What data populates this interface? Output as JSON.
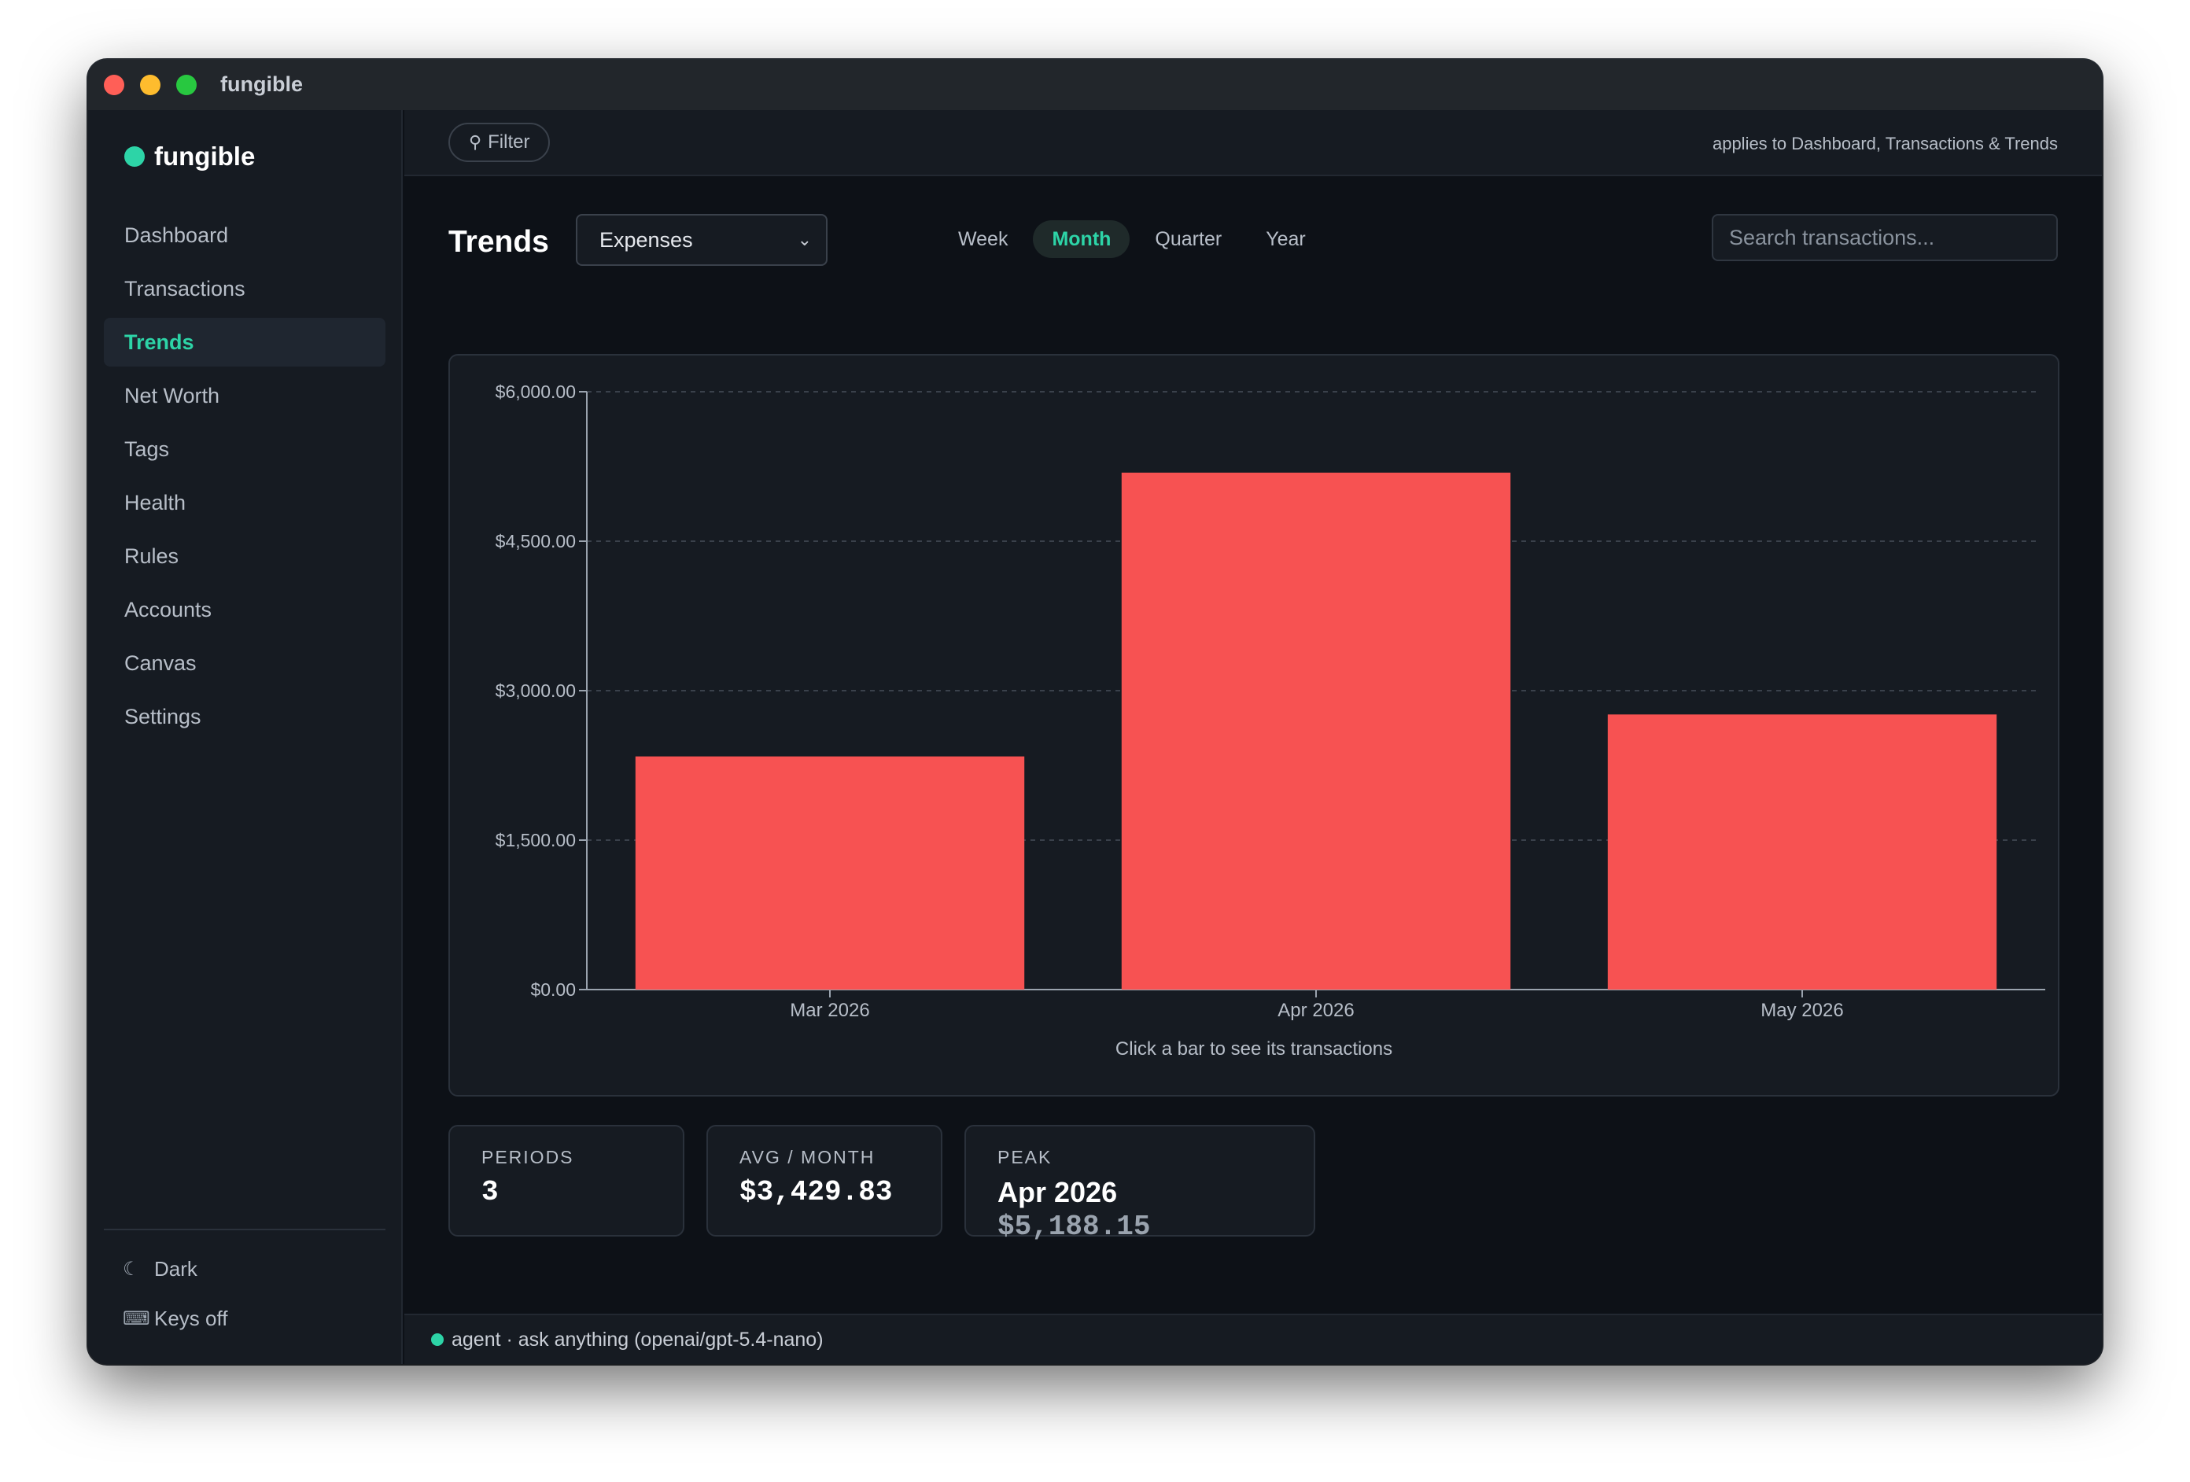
{
  "window": {
    "title": "fungible"
  },
  "sidebar": {
    "brand": "fungible",
    "items": [
      {
        "label": "Dashboard"
      },
      {
        "label": "Transactions"
      },
      {
        "label": "Trends"
      },
      {
        "label": "Net Worth"
      },
      {
        "label": "Tags"
      },
      {
        "label": "Health"
      },
      {
        "label": "Rules"
      },
      {
        "label": "Accounts"
      },
      {
        "label": "Canvas"
      },
      {
        "label": "Settings"
      }
    ],
    "active_index": 2,
    "theme_label": "Dark",
    "keys_label": "Keys off"
  },
  "filterbar": {
    "filter_label": "Filter",
    "note": "applies to Dashboard, Transactions & Trends"
  },
  "trends": {
    "title": "Trends",
    "select_value": "Expenses",
    "periods": [
      "Week",
      "Month",
      "Quarter",
      "Year"
    ],
    "active_period": "Month",
    "search_placeholder": "Search transactions..."
  },
  "colors": {
    "accent": "#2dd4a7",
    "bar": "#f75252"
  },
  "chart_data": {
    "type": "bar",
    "categories": [
      "Mar 2026",
      "Apr 2026",
      "May 2026"
    ],
    "values": [
      2340,
      5188.15,
      2761
    ],
    "ylim": [
      0,
      6000
    ],
    "yticks": [
      0,
      1500,
      3000,
      4500,
      6000
    ],
    "ytick_labels": [
      "$0.00",
      "$1,500.00",
      "$3,000.00",
      "$4,500.00",
      "$6,000.00"
    ],
    "grid": true,
    "hint": "Click a bar to see its transactions"
  },
  "stats": {
    "periods_label": "PERIODS",
    "periods_value": "3",
    "avg_label": "AVG / MONTH",
    "avg_value": "$3,429.83",
    "peak_label": "PEAK",
    "peak_period": "Apr 2026",
    "peak_value": "$5,188.15"
  },
  "agent": {
    "text": "agent · ask anything (openai/gpt-5.4-nano)"
  }
}
